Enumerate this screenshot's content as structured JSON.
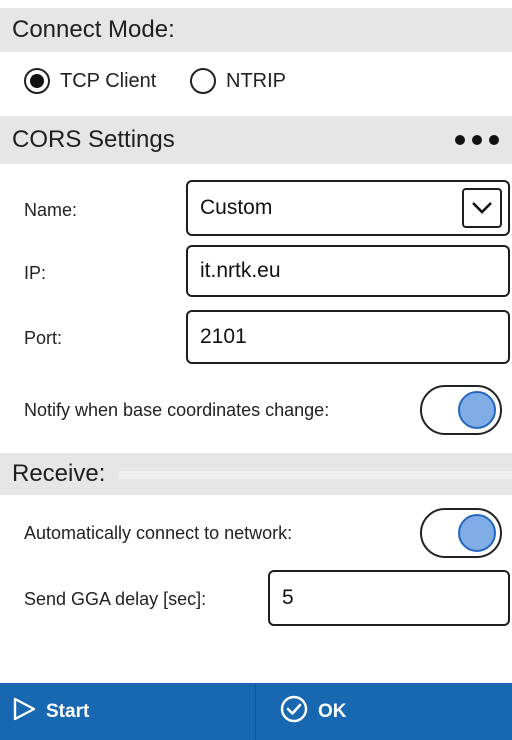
{
  "connect_mode": {
    "header": "Connect Mode:",
    "options": [
      {
        "label": "TCP Client",
        "selected": true
      },
      {
        "label": "NTRIP",
        "selected": false
      }
    ]
  },
  "cors_settings": {
    "header": "CORS Settings",
    "more_icon": "more-horizontal-icon",
    "name_label": "Name:",
    "name_value": "Custom",
    "ip_label": "IP:",
    "ip_value": "it.nrtk.eu",
    "port_label": "Port:",
    "port_value": "2101",
    "notify_label": "Notify when base coordinates change:",
    "notify_on": true
  },
  "receive": {
    "header": "Receive:",
    "auto_connect_label": "Automatically connect to network:",
    "auto_connect_on": true,
    "gga_label": "Send GGA delay [sec]:",
    "gga_value": "5"
  },
  "footer": {
    "start_label": "Start",
    "start_icon": "play-triangle-icon",
    "ok_label": "OK",
    "ok_icon": "check-circle-icon"
  },
  "colors": {
    "footer_bg": "#1768b0",
    "toggle_knob": "#80ace5",
    "section_bg": "#e6e6e6"
  }
}
